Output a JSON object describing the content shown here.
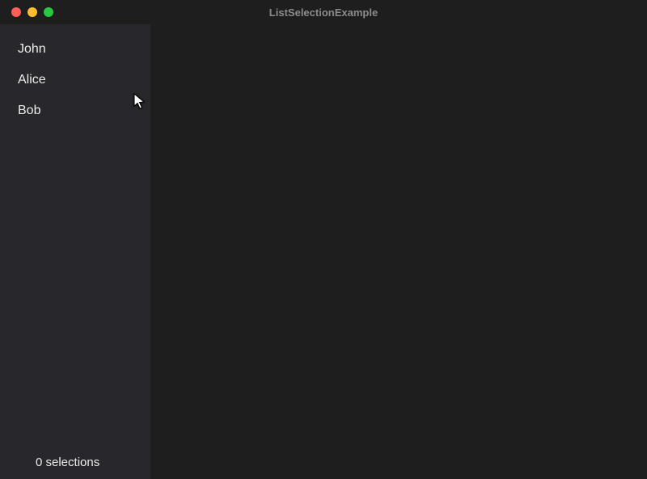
{
  "window": {
    "title": "ListSelectionExample"
  },
  "sidebar": {
    "items": [
      {
        "label": "John"
      },
      {
        "label": "Alice"
      },
      {
        "label": "Bob"
      }
    ],
    "status": "0 selections"
  }
}
